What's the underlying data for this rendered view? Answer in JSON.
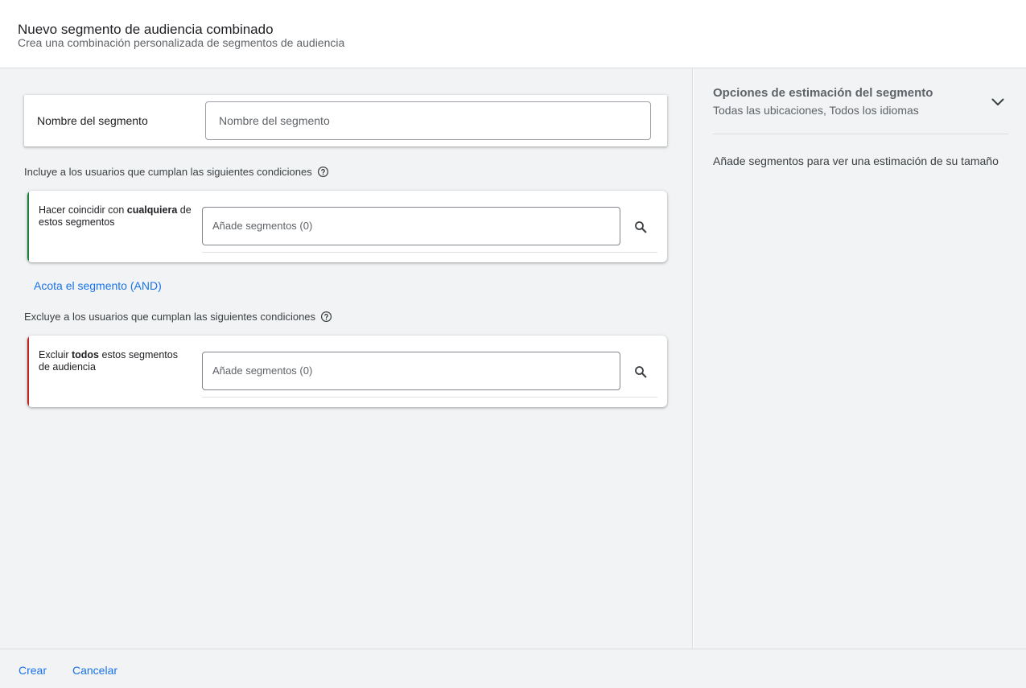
{
  "header": {
    "title": "Nuevo segmento de audiencia combinado",
    "subtitle": "Crea una combinación personalizada de segmentos de audiencia"
  },
  "name_card": {
    "label": "Nombre del segmento",
    "input_placeholder": "Nombre del segmento"
  },
  "include": {
    "heading": "Incluye a los usuarios que cumplan las siguientes condiciones",
    "help_icon": "help-circle-icon",
    "condition_prefix": "Hacer coincidir con ",
    "condition_bold": "cualquiera",
    "condition_suffix": " de estos segmentos",
    "input_placeholder": "Añade segmentos (0)",
    "search_icon": "search-icon",
    "stripe_color": "#188038"
  },
  "narrow_link": "Acota el segmento (AND)",
  "exclude": {
    "heading": "Excluye a los usuarios que cumplan las siguientes condiciones",
    "help_icon": "help-circle-icon",
    "condition_prefix": "Excluir ",
    "condition_bold": "todos",
    "condition_suffix": " estos segmentos de audiencia",
    "input_placeholder": "Añade segmentos (0)",
    "search_icon": "search-icon",
    "stripe_color": "#c5221f"
  },
  "estimation": {
    "title": "Opciones de estimación del segmento",
    "subtitle": "Todas las ubicaciones, Todos los idiomas",
    "expand_icon": "chevron-down-icon",
    "empty_message": "Añade segmentos para ver una estimación de su tamaño"
  },
  "footer": {
    "create_label": "Crear",
    "cancel_label": "Cancelar"
  },
  "colors": {
    "link": "#1a73e8",
    "background": "#f1f3f4"
  }
}
